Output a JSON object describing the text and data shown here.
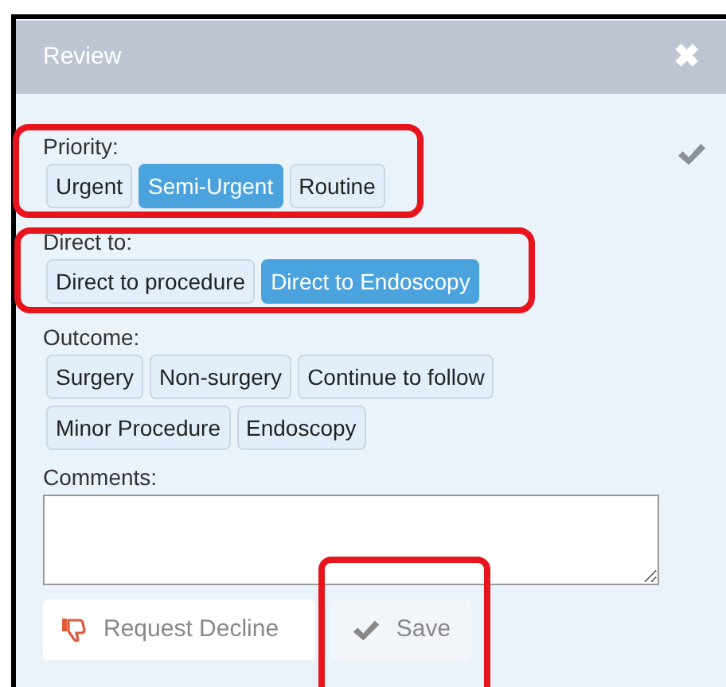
{
  "window": {
    "title": "Review",
    "close": "✖"
  },
  "groups": [
    {
      "label": "Priority:",
      "options": [
        {
          "label": "Urgent",
          "selected": false
        },
        {
          "label": "Semi-Urgent",
          "selected": true
        },
        {
          "label": "Routine",
          "selected": false
        }
      ]
    },
    {
      "label": "Direct to:",
      "options": [
        {
          "label": "Direct to procedure",
          "selected": false
        },
        {
          "label": "Direct to Endoscopy",
          "selected": true
        }
      ]
    },
    {
      "label": "Outcome:",
      "options": [
        {
          "label": "Surgery",
          "selected": false
        },
        {
          "label": "Non-surgery",
          "selected": false
        },
        {
          "label": "Continue to follow",
          "selected": false
        },
        {
          "label": "Minor Procedure",
          "selected": false
        },
        {
          "label": "Endoscopy",
          "selected": false
        }
      ]
    }
  ],
  "comments": {
    "label": "Comments:"
  },
  "buttons": [
    {
      "label": "Request Decline",
      "kind": "decline"
    },
    {
      "label": "Save",
      "kind": "save"
    }
  ]
}
